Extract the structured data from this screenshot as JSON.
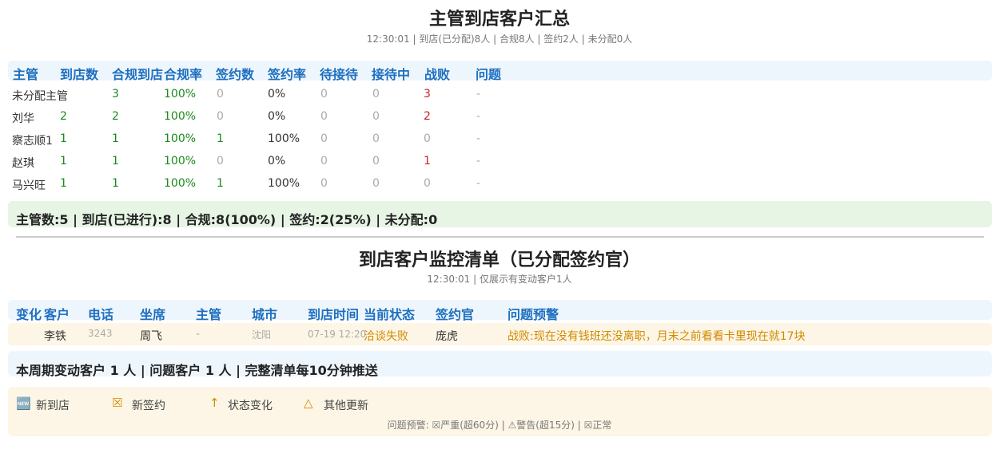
{
  "summary_section": {
    "title": "主管到店客户汇总",
    "subtitle": "12:30:01 | 到店(已分配)8人 | 合规8人 | 签约2人 | 未分配0人",
    "columns": [
      "主管",
      "到店数",
      "合规到店",
      "合规率",
      "签约数",
      "签约率",
      "待接待",
      "接待中",
      "战败",
      "问题"
    ],
    "rows": [
      [
        "未分配主管",
        "",
        "3",
        "100%",
        "0",
        "0%",
        "0",
        "0",
        "3",
        "-"
      ],
      [
        "刘华",
        "2",
        "2",
        "100%",
        "0",
        "0%",
        "0",
        "0",
        "2",
        "-"
      ],
      [
        "察志顺1",
        "1",
        "1",
        "100%",
        "1",
        "100%",
        "0",
        "0",
        "0",
        "-"
      ],
      [
        "赵琪",
        "1",
        "1",
        "100%",
        "0",
        "0%",
        "0",
        "0",
        "1",
        "-"
      ],
      [
        "马兴旺",
        "1",
        "1",
        "100%",
        "1",
        "100%",
        "0",
        "0",
        "0",
        "-"
      ]
    ],
    "totals": "主管数:5 | 到店(已进行):8 | 合规:8(100%) | 签约:2(25%) | 未分配:0"
  },
  "monitor_section": {
    "title": "到店客户监控清单（已分配签约官）",
    "subtitle": "12:30:01 | 仅展示有变动客户1人",
    "columns": [
      "变化",
      "客户",
      "电话",
      "坐席",
      "主管",
      "城市",
      "到店时间",
      "当前状态",
      "签约官",
      "问题预警"
    ],
    "rows": [
      [
        "",
        "李铁",
        "3243",
        "周飞",
        "-",
        "沈阳",
        "07-19 12:20",
        "洽谈失败",
        "庞虎",
        "战败:现在没有钱班还没离职，月末之前看看卡里现在就17块"
      ]
    ],
    "push_note": "本周期变动客户 1 人 | 问题客户 1 人 | 完整清单每10分钟推送"
  },
  "legend": {
    "items": [
      {
        "icon": "new-icon",
        "glyph": "🆕",
        "label": "新到店"
      },
      {
        "icon": "sign-icon",
        "glyph": "☒",
        "label": "新签约"
      },
      {
        "icon": "arrow-up-icon",
        "glyph": "↑",
        "label": "状态变化"
      },
      {
        "icon": "triangle-icon",
        "glyph": "△",
        "label": "其他更新"
      }
    ],
    "warning_note": "问题预警: ☒严重(超60分) | ⚠警告(超15分) | ☒正常"
  },
  "colors": {
    "header_blue": "#1e6fbf",
    "good_green": "#1a8a1a",
    "bad_red": "#cc1f1f",
    "warn_orange": "#d28a00",
    "summary_bg": "#e7f5e5",
    "header_bg": "#eef6fd",
    "legend_bg": "#fdf6e6"
  }
}
